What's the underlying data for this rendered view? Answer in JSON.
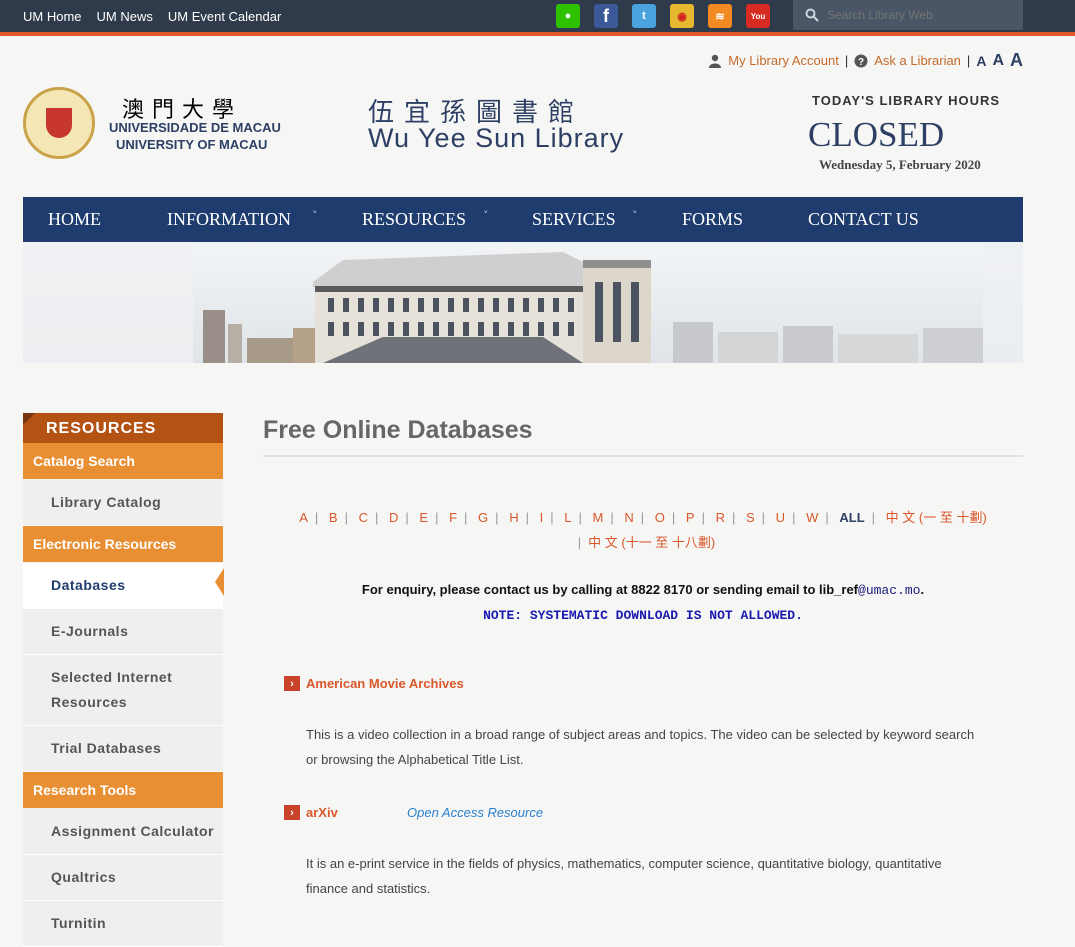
{
  "topbar": {
    "links": [
      "UM Home",
      "UM News",
      "UM Event Calendar"
    ],
    "social_icons": [
      "wechat-icon",
      "facebook-icon",
      "twitter-icon",
      "weibo-icon",
      "rss-icon",
      "youtube-icon"
    ],
    "search_placeholder": "Search Library Web"
  },
  "account": {
    "my_account": "My Library Account",
    "ask": "Ask a Librarian",
    "font_sizes": [
      "A",
      "A",
      "A"
    ]
  },
  "header": {
    "um_cn": "澳門大學",
    "um_en1": "UNIVERSIDADE DE MACAU",
    "um_en2": "UNIVERSITY OF MACAU",
    "lib_cn": "伍宜孫圖書館",
    "lib_en": "Wu Yee Sun Library",
    "hours_title": "TODAY'S LIBRARY HOURS",
    "hours_status": "CLOSED",
    "hours_date": "Wednesday 5, February 2020"
  },
  "nav": [
    "HOME",
    "INFORMATION",
    "RESOURCES",
    "SERVICES",
    "FORMS",
    "CONTACT US"
  ],
  "sidebar": {
    "heading": "RESOURCES",
    "sections": [
      {
        "title": "Catalog Search",
        "items": [
          "Library Catalog"
        ]
      },
      {
        "title": "Electronic Resources",
        "items": [
          "Databases",
          "E-Journals",
          "Selected Internet Resources",
          "Trial Databases"
        ]
      },
      {
        "title": "Research Tools",
        "items": [
          "Assignment Calculator",
          "Qualtrics",
          "Turnitin"
        ]
      }
    ]
  },
  "main": {
    "title": "Free Online Databases",
    "letters": [
      "A",
      "B",
      "C",
      "D",
      "E",
      "F",
      "G",
      "H",
      "I",
      "L",
      "M",
      "N",
      "O",
      "P",
      "R",
      "S",
      "U",
      "W"
    ],
    "all": "ALL",
    "cn1": "中 文 (一 至 十劃)",
    "cn2": "中 文 (十一 至 十八劃)",
    "enquiry_text": "For enquiry, please contact us by calling at 8822 8170 or sending email to lib_ref",
    "enquiry_mail": "@umac.mo",
    "enquiry_end": ".",
    "note": "NOTE: SYSTEMATIC DOWNLOAD IS NOT ALLOWED.",
    "databases": [
      {
        "name": "American Movie Archives",
        "tag": "",
        "desc": "This is a video collection in a broad range of subject areas and topics. The video can be selected by keyword search or browsing the Alphabetical Title List."
      },
      {
        "name": "arXiv",
        "tag": "Open Access Resource",
        "desc": "It is an e-print service in the fields of physics, mathematics, computer science, quantitative biology, quantitative finance and statistics."
      }
    ]
  }
}
